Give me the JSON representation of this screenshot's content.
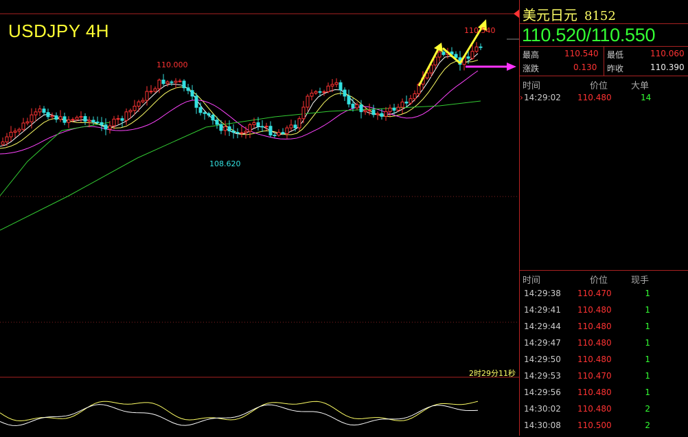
{
  "chart": {
    "title": "USDJPY 4H",
    "high_label": "110.000",
    "low_label": "108.620",
    "recent_high_label": "110.540",
    "countdown": "2时29分11秒"
  },
  "quote": {
    "name": "美元日元",
    "code": "8152",
    "bid_ask": "110.520/110.550",
    "stats": {
      "high_label": "最高",
      "high_value": "110.540",
      "low_label": "最低",
      "low_value": "110.060",
      "change_label": "涨跌",
      "change_value": "0.130",
      "prev_close_label": "昨收",
      "prev_close_value": "110.390"
    }
  },
  "big_orders": {
    "headers": [
      "时间",
      "价位",
      "大单"
    ],
    "rows": [
      {
        "time": "14:29:02",
        "price": "110.480",
        "volume": "14"
      }
    ]
  },
  "ticks": {
    "headers": [
      "时间",
      "价位",
      "现手"
    ],
    "rows": [
      {
        "time": "14:29:38",
        "price": "110.470",
        "volume": "1"
      },
      {
        "time": "14:29:41",
        "price": "110.480",
        "volume": "1"
      },
      {
        "time": "14:29:44",
        "price": "110.480",
        "volume": "1"
      },
      {
        "time": "14:29:47",
        "price": "110.480",
        "volume": "1"
      },
      {
        "time": "14:29:50",
        "price": "110.480",
        "volume": "1"
      },
      {
        "time": "14:29:53",
        "price": "110.470",
        "volume": "1"
      },
      {
        "time": "14:29:56",
        "price": "110.480",
        "volume": "1"
      },
      {
        "time": "14:30:02",
        "price": "110.480",
        "volume": "2"
      },
      {
        "time": "14:30:08",
        "price": "110.500",
        "volume": "2"
      }
    ]
  },
  "colors": {
    "bull": "#ff3333",
    "bear": "#33e0e0",
    "ma_fast": "#ffffff",
    "ma_mid": "#ffff66",
    "ma_slow": "#ff44ff",
    "ma_long": "#33cc33",
    "arrow_up": "#ffff33",
    "arrow_side": "#ff33ff"
  }
}
